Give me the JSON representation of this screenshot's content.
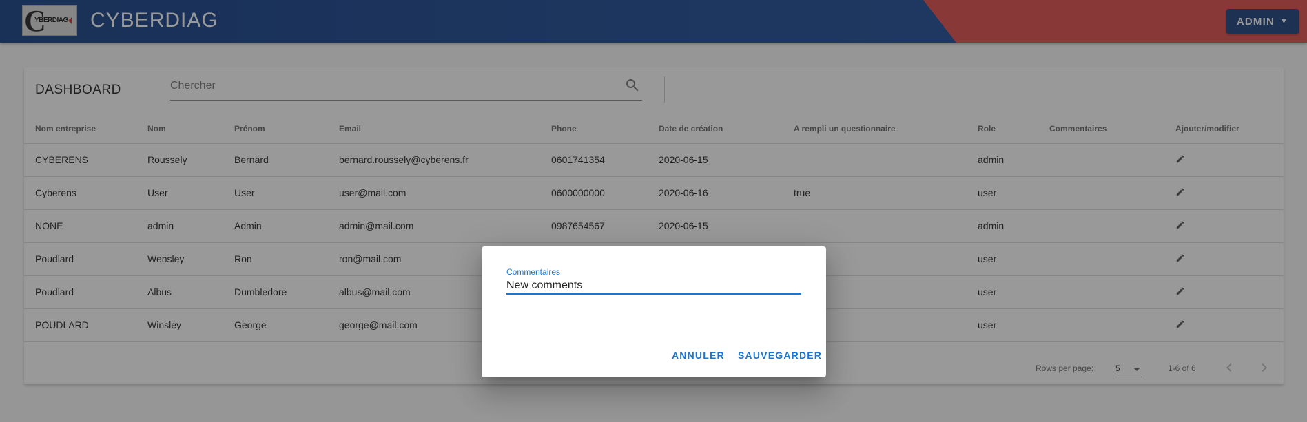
{
  "header": {
    "logo_text": "YBERDIAG",
    "logo_letter": "C",
    "app_title": "CYBERDIAG",
    "admin_menu": "ADMIN",
    "caret": "▼"
  },
  "dashboard": {
    "title": "DASHBOARD",
    "search_placeholder": "Chercher",
    "columns": [
      "Nom entreprise",
      "Nom",
      "Prénom",
      "Email",
      "Phone",
      "Date de création",
      "A rempli un questionnaire",
      "Role",
      "Commentaires",
      "Ajouter/modifier"
    ],
    "rows": [
      {
        "company": "CYBERENS",
        "nom": "Roussely",
        "prenom": "Bernard",
        "email": "bernard.roussely@cyberens.fr",
        "phone": "0601741354",
        "date": "2020-06-15",
        "questionnaire": "",
        "role": "admin",
        "comments": ""
      },
      {
        "company": "Cyberens",
        "nom": "User",
        "prenom": "User",
        "email": "user@mail.com",
        "phone": "0600000000",
        "date": "2020-06-16",
        "questionnaire": "true",
        "role": "user",
        "comments": ""
      },
      {
        "company": "NONE",
        "nom": "admin",
        "prenom": "Admin",
        "email": "admin@mail.com",
        "phone": "0987654567",
        "date": "2020-06-15",
        "questionnaire": "",
        "role": "admin",
        "comments": ""
      },
      {
        "company": "Poudlard",
        "nom": "Wensley",
        "prenom": "Ron",
        "email": "ron@mail.com",
        "phone": "",
        "date": "",
        "questionnaire": "",
        "role": "user",
        "comments": ""
      },
      {
        "company": "Poudlard",
        "nom": "Albus",
        "prenom": "Dumbledore",
        "email": "albus@mail.com",
        "phone": "",
        "date": "",
        "questionnaire": "",
        "role": "user",
        "comments": ""
      },
      {
        "company": "POUDLARD",
        "nom": "Winsley",
        "prenom": "George",
        "email": "george@mail.com",
        "phone": "",
        "date": "",
        "questionnaire": "",
        "role": "user",
        "comments": ""
      }
    ],
    "footer": {
      "rows_per_page_label": "Rows per page:",
      "rows_per_page_value": "5",
      "page_info": "1-6 of 6"
    }
  },
  "dialog": {
    "field_label": "Commentaires",
    "field_value": "New comments",
    "cancel": "ANNULER",
    "save": "SAUVEGARDER"
  },
  "colors": {
    "header_blue": "#143f86",
    "header_red": "#e24c4c",
    "accent": "#1976d2"
  },
  "icons": [
    "search-icon",
    "pencil-icon",
    "chevron-left-icon",
    "chevron-right-icon",
    "caret-down-icon"
  ]
}
